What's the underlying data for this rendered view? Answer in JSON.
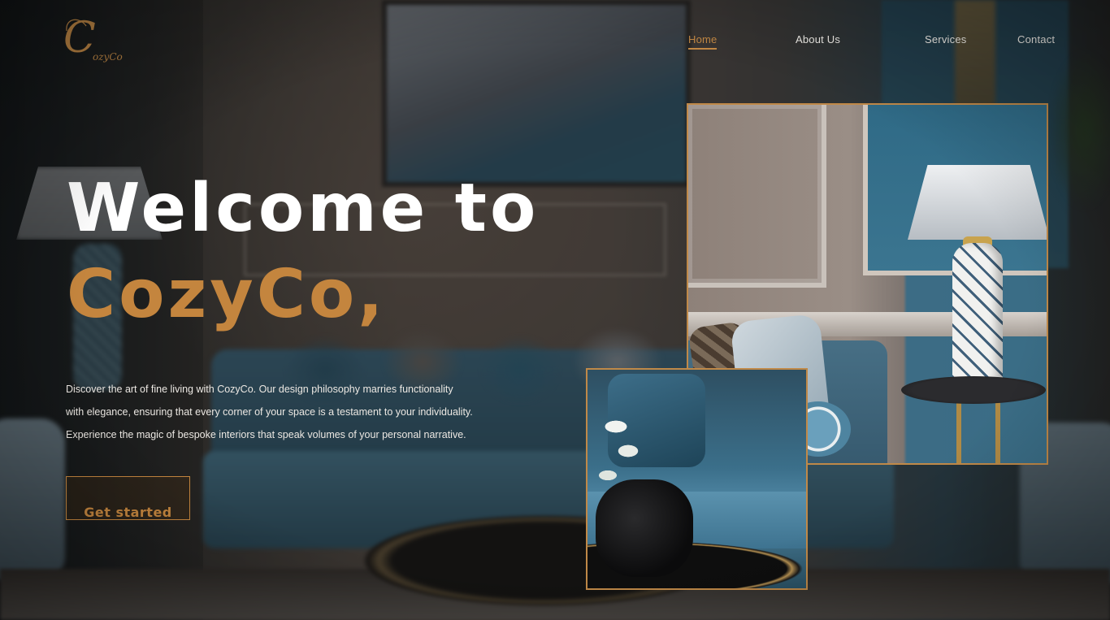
{
  "brand": {
    "logo_letter": "C",
    "logo_script": "ozyCo",
    "accent_color": "#c4853e",
    "text_color": "#ffffff"
  },
  "nav": {
    "items": [
      {
        "label": "Home",
        "active": true
      },
      {
        "label": "About Us",
        "active": false
      },
      {
        "label": "Services",
        "active": false
      },
      {
        "label": "Contact",
        "active": false
      }
    ]
  },
  "hero": {
    "title_line1": "Welcome to",
    "title_line2": "CozyCo,",
    "description_lines": [
      "Discover the art of fine living with CozyCo. Our design philosophy marries functionality",
      "with elegance, ensuring that every corner of your space is a testament to your individuality.",
      "Experience the magic of bespoke interiors that speak volumes of your personal narrative."
    ],
    "cta_label": "Get started"
  },
  "images": {
    "large_photo": "living-room-lamp-photo",
    "small_photo": "sofa-coffee-table-photo"
  }
}
